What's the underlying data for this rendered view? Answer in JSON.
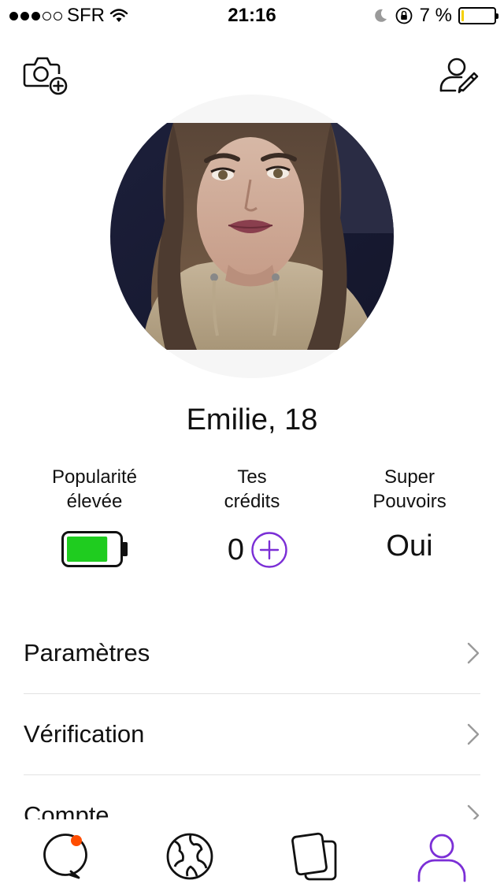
{
  "status_bar": {
    "carrier": "SFR",
    "time": "21:16",
    "battery_percent": "7 %",
    "signal_strength": 3,
    "signal_total": 5,
    "battery_level": 0.07,
    "battery_color": "#f5d000"
  },
  "profile": {
    "name_age": "Emilie, 18"
  },
  "stats": {
    "popularity": {
      "line1": "Popularité",
      "line2": "élevée",
      "battery_level": 0.8,
      "battery_color": "#1fcc1f"
    },
    "credits": {
      "line1": "Tes",
      "line2": "crédits",
      "value": "0"
    },
    "super_powers": {
      "line1": "Super",
      "line2": "Pouvoirs",
      "value": "Oui"
    }
  },
  "menu": {
    "items": [
      {
        "label": "Paramètres"
      },
      {
        "label": "Vérification"
      },
      {
        "label": "Compte"
      }
    ]
  },
  "tab_bar": {
    "tabs": [
      {
        "icon": "chat-icon",
        "has_notification": true
      },
      {
        "icon": "globe-icon"
      },
      {
        "icon": "cards-icon"
      },
      {
        "icon": "profile-icon",
        "active": true
      }
    ]
  },
  "colors": {
    "accent": "#7b2fd6",
    "notification": "#ff4d00",
    "popularity_green": "#1fcc1f"
  }
}
